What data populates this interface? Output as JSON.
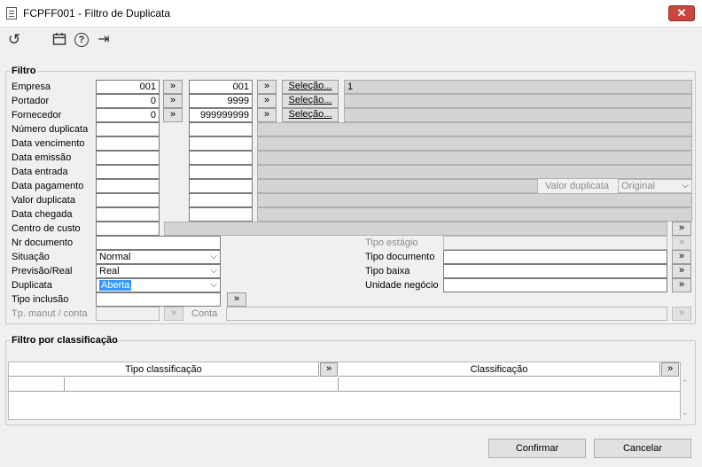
{
  "window": {
    "title": "FCPFF001 - Filtro de Duplicata",
    "close": "✕"
  },
  "toolbar": {
    "undo": "↺",
    "calendar": "📅",
    "help": "?",
    "exit": "⇥"
  },
  "filtro": {
    "legend": "Filtro",
    "labels": {
      "empresa": "Empresa",
      "portador": "Portador",
      "fornecedor": "Fornecedor",
      "numero_duplicata": "Número duplicata",
      "data_vencimento": "Data vencimento",
      "data_emissao": "Data emissão",
      "data_entrada": "Data entrada",
      "data_pagamento": "Data pagamento",
      "valor_duplicata": "Valor duplicata",
      "data_chegada": "Data chegada",
      "centro_custo": "Centro de custo",
      "nr_documento": "Nr documento",
      "situacao": "Situação",
      "previsao_real": "Previsão/Real",
      "duplicata": "Duplicata",
      "tipo_inclusao": "Tipo inclusão",
      "tp_manut_conta": "Tp. manut / conta",
      "conta": "Conta",
      "tipo_estagio": "Tipo estágio",
      "tipo_documento": "Tipo documento",
      "tipo_baixa": "Tipo baixa",
      "unidade_negocio": "Unidade negócio",
      "valor_duplicata_right": "Valor duplicata"
    },
    "values": {
      "empresa_de": "001",
      "empresa_ate": "001",
      "empresa_desc": "1",
      "portador_de": "0",
      "portador_ate": "9999",
      "fornecedor_de": "0",
      "fornecedor_ate": "999999999",
      "situacao": "Normal",
      "previsao_real": "Real",
      "duplicata": "Aberta",
      "valor_duplicata_tipo": "Original"
    },
    "selecao_label": "Seleção...",
    "go": "»"
  },
  "classificacao": {
    "legend": "Filtro por classificação",
    "columns": [
      "Tipo classificação",
      "Classificação"
    ],
    "go": "»"
  },
  "footer": {
    "confirmar": "Confirmar",
    "cancelar": "Cancelar"
  }
}
